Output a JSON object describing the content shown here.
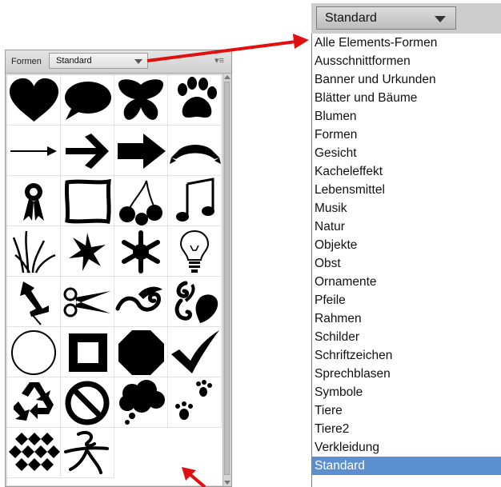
{
  "panel": {
    "label": "Formen",
    "select_value": "Standard",
    "menu_icon": "panel-menu-icon",
    "shapes": [
      "heart-icon",
      "speech-bubble-icon",
      "butterfly-icon",
      "paw-print-icon",
      "thin-arrow-icon",
      "bold-arrow-icon",
      "block-arrow-icon",
      "banner-ribbon-icon",
      "award-ribbon-icon",
      "frame-icon",
      "cherries-icon",
      "music-note-icon",
      "grass-icon",
      "star-flower-icon",
      "snowflake-icon",
      "light-bulb-icon",
      "pushpin-icon",
      "scissors-icon",
      "ornament-swirl-icon",
      "floral-ornament-icon",
      "circle-outline-icon",
      "square-frame-icon",
      "octagon-icon",
      "checkmark-icon",
      "recycle-icon",
      "no-sign-icon",
      "thought-bubble-icon",
      "paw-tracks-icon",
      "diamond-pattern-icon",
      "symbol-glyph-icon"
    ]
  },
  "dropdown": {
    "value": "Standard",
    "items": [
      "Alle Elements-Formen",
      "Ausschnittformen",
      "Banner und Urkunden",
      "Blätter und Bäume",
      "Blumen",
      "Formen",
      "Gesicht",
      "Kacheleffekt",
      "Lebensmittel",
      "Musik",
      "Natur",
      "Objekte",
      "Obst",
      "Ornamente",
      "Pfeile",
      "Rahmen",
      "Schilder",
      "Schriftzeichen",
      "Sprechblasen",
      "Symbole",
      "Tiere",
      "Tiere2",
      "Verkleidung",
      "Standard"
    ],
    "selected_index": 23
  },
  "colors": {
    "selection": "#5b8fd0",
    "annotation_arrow": "#e01010"
  }
}
